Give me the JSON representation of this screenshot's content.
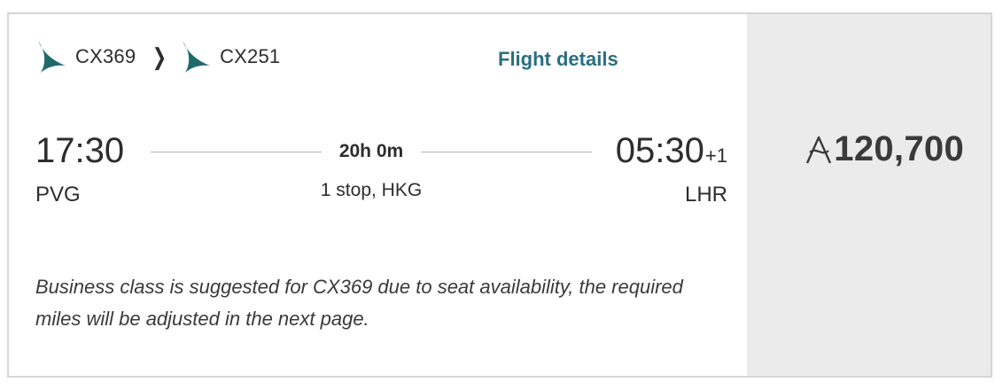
{
  "itinerary": {
    "segments": [
      {
        "flight": "CX369"
      },
      {
        "flight": "CX251"
      }
    ],
    "details_link": "Flight details",
    "departure": {
      "time": "17:30",
      "airport": "PVG"
    },
    "arrival": {
      "time": "05:30",
      "day_offset": "+1",
      "airport": "LHR"
    },
    "duration": "20h 0m",
    "stops": "1 stop, HKG",
    "note": "Business class is suggested for CX369 due to seat availability, the required miles will be adjusted in the next page."
  },
  "price": {
    "currency_icon": "asia-miles-icon",
    "value": "120,700"
  },
  "colors": {
    "brand_green": "#1f6b6b",
    "link": "#2a6f80",
    "price_panel": "#ebebeb",
    "text": "#2d2d2d"
  }
}
